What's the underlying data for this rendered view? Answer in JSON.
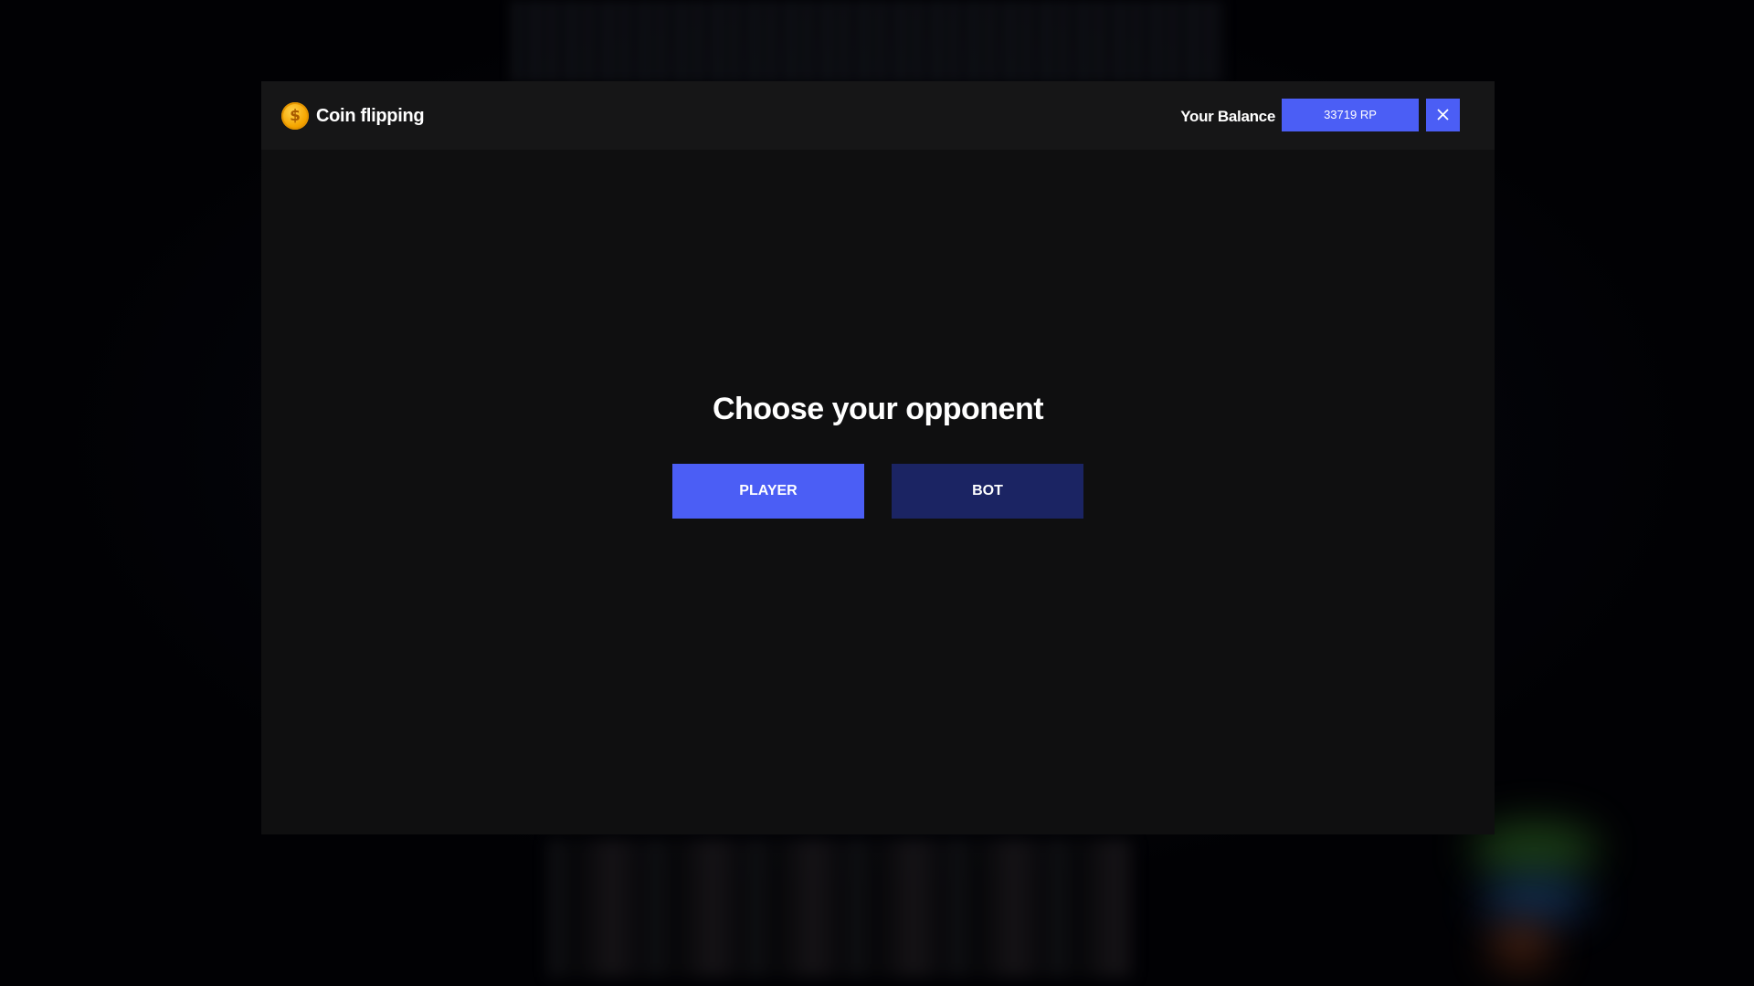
{
  "modal": {
    "title": "Coin flipping",
    "balance_label": "Your Balance",
    "balance_value": "33719 RP",
    "close_icon": "close-icon",
    "coin_icon": "coin-icon"
  },
  "main": {
    "heading": "Choose your opponent",
    "options": [
      {
        "label": "PLAYER",
        "selected": true
      },
      {
        "label": "BOT",
        "selected": false
      }
    ]
  },
  "colors": {
    "accent": "#4b5ef5",
    "accent_dark": "#1b2463",
    "panel": "#0f0f10",
    "header": "#161617",
    "coin": "#f5a500"
  }
}
